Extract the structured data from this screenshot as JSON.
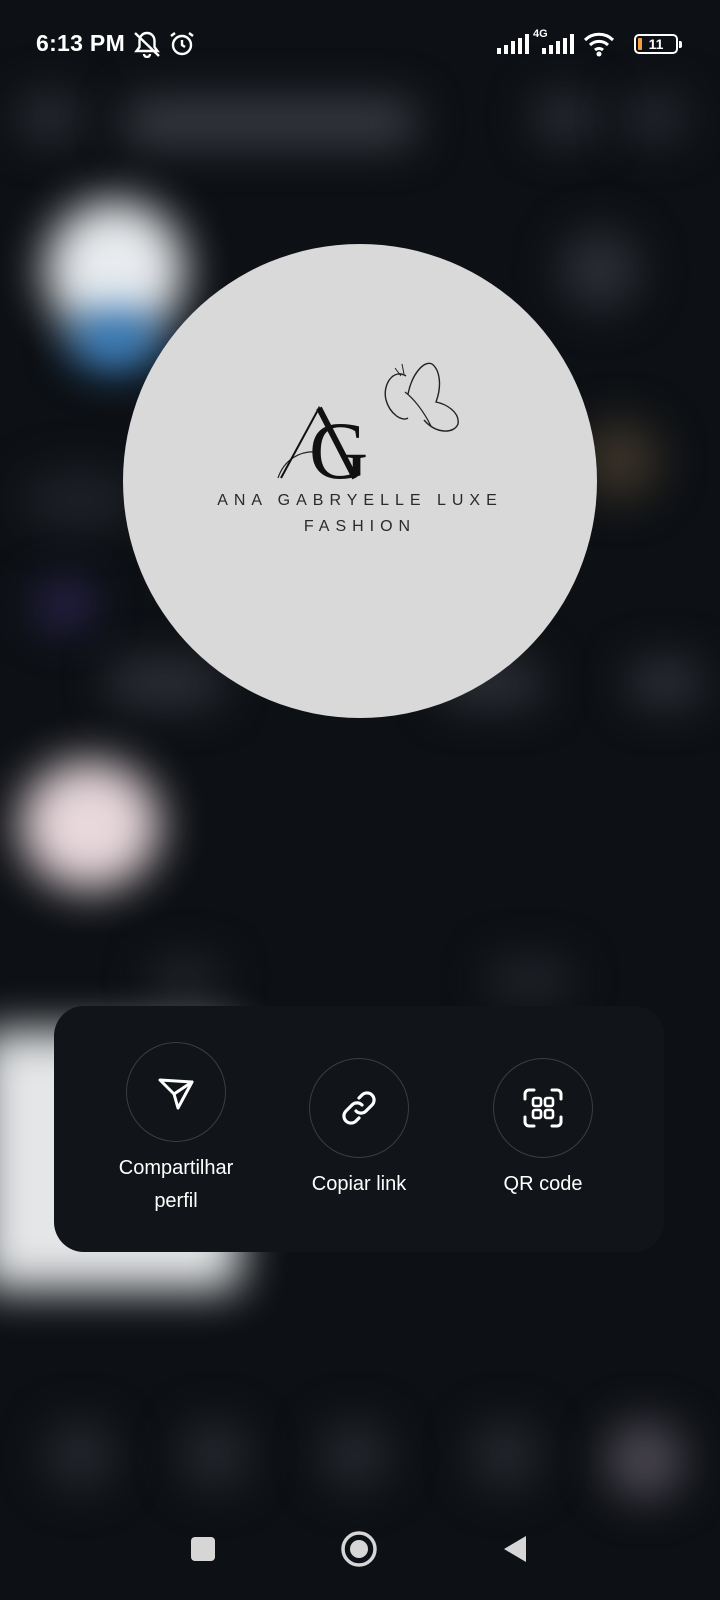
{
  "status_bar": {
    "time": "6:13 PM",
    "network": "4G",
    "battery_level": "11",
    "icons": [
      "bell-muted-icon",
      "alarm-icon",
      "signal-icon",
      "signal-4g-icon",
      "wifi-icon",
      "battery-icon"
    ]
  },
  "profile": {
    "logo_text": "AG",
    "brand_line1": "ANA GABRYELLE LUXE",
    "brand_line2": "FASHION"
  },
  "share_actions": [
    {
      "label": "Compartilhar perfil",
      "icon": "send-icon"
    },
    {
      "label": "Copiar link",
      "icon": "link-icon"
    },
    {
      "label": "QR code",
      "icon": "qr-code-icon"
    }
  ],
  "navigation": {
    "buttons": [
      "recents-button",
      "home-button",
      "back-button"
    ]
  },
  "colors": {
    "background": "#0d1014",
    "panel": "#111418",
    "avatar": "#d9d9d9",
    "battery_low": "#f4a13c"
  }
}
